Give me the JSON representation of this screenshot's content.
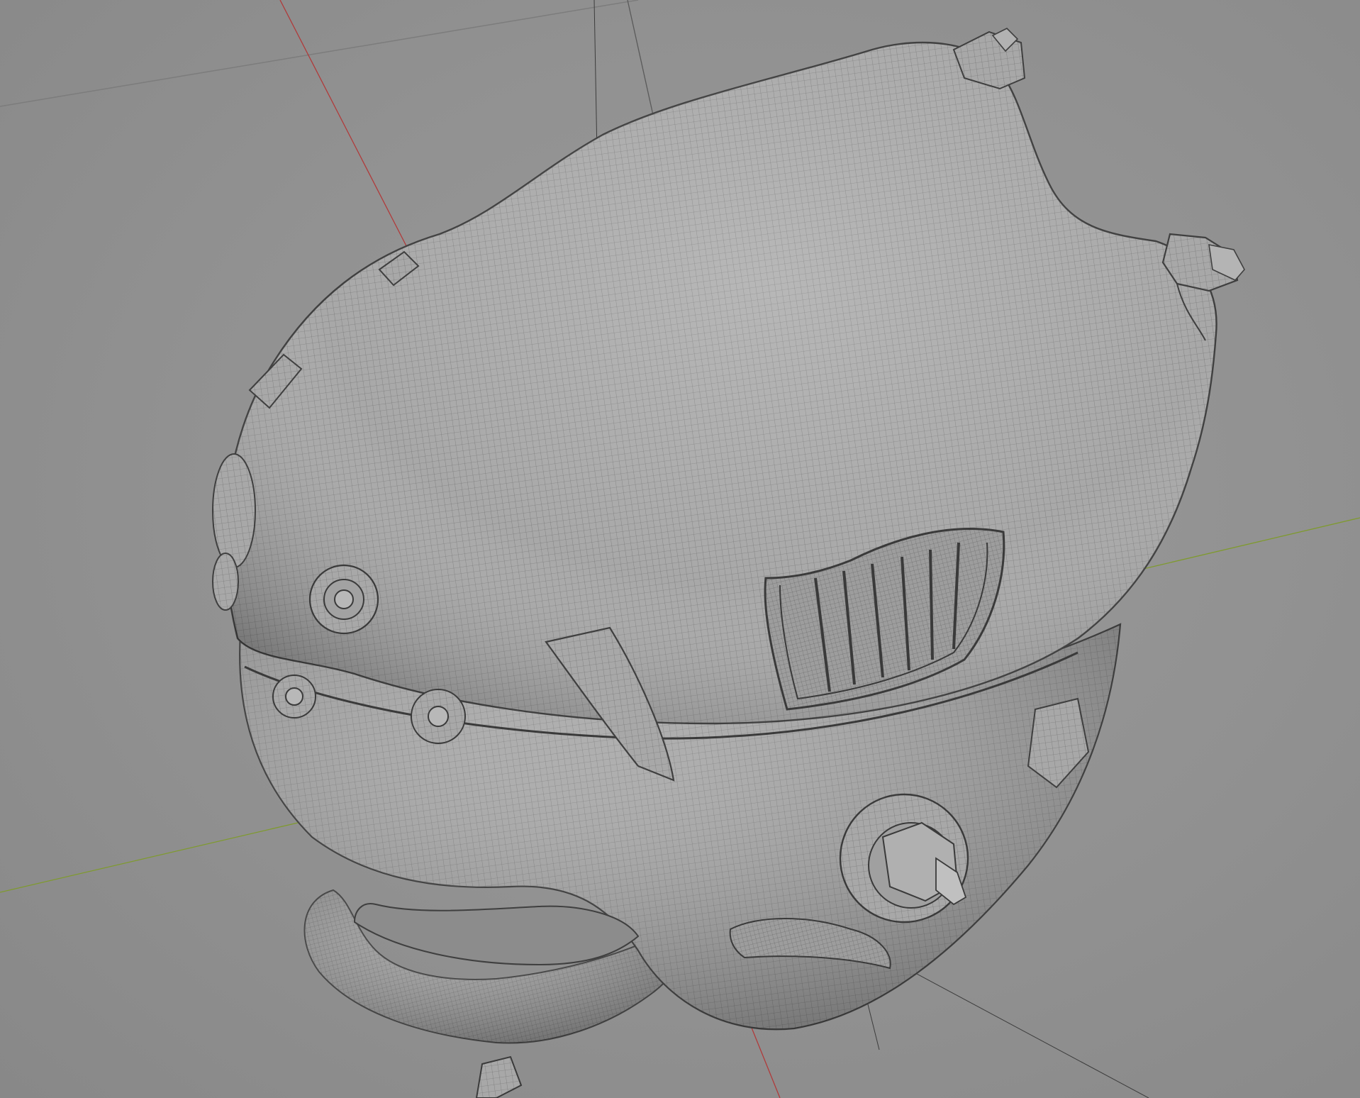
{
  "viewport": {
    "background_color": "#8f8f8f",
    "x_axis_color": "#b03a3a",
    "y_axis_color": "#7f9a2e",
    "grid_line_color": "#7a7a7a",
    "mesh_fill_color": "#a7a7a7",
    "wire_color": "#4a4a4a"
  },
  "object": {
    "icon": "mesh-object-icon",
    "shading": "wireframe-overlay"
  }
}
